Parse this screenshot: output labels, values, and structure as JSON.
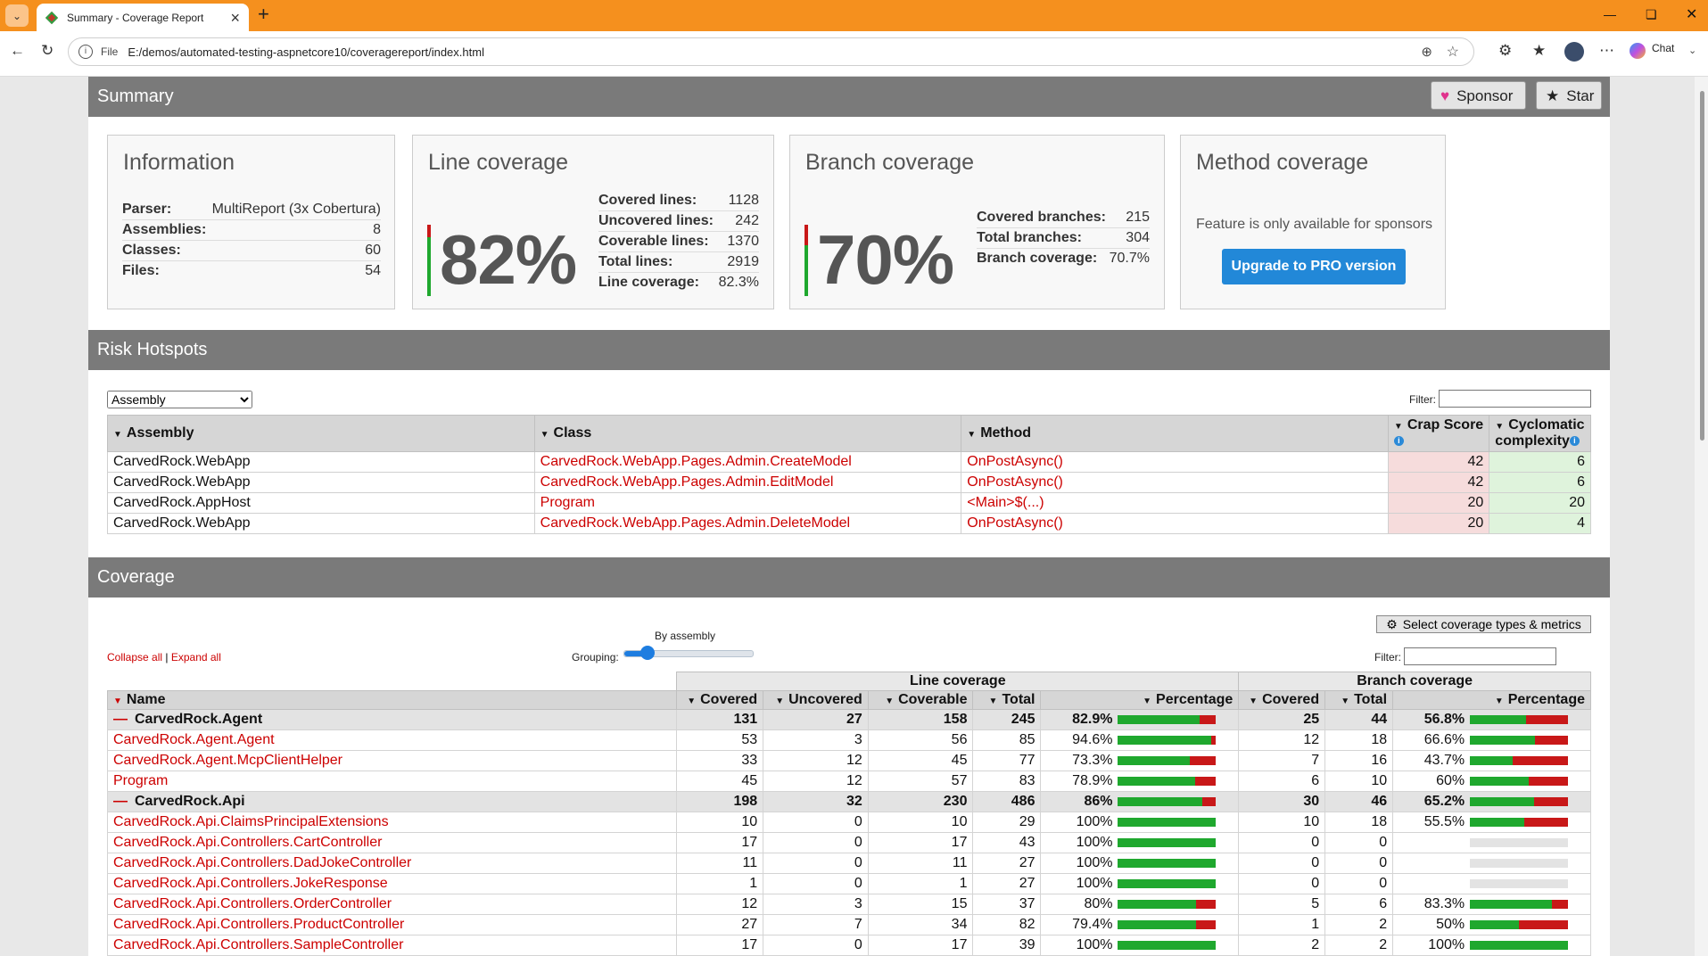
{
  "browser": {
    "tab_title": "Summary - Coverage Report",
    "url_scheme": "File",
    "url": "E:/demos/automated-testing-aspnetcore10/coveragereport/index.html",
    "chat_label": "Chat"
  },
  "summary": {
    "title": "Summary",
    "sponsor_label": "Sponsor",
    "star_label": "Star",
    "information": {
      "title": "Information",
      "rows": [
        {
          "k": "Parser:",
          "v": "MultiReport (3x Cobertura)"
        },
        {
          "k": "Assemblies:",
          "v": "8"
        },
        {
          "k": "Classes:",
          "v": "60"
        },
        {
          "k": "Files:",
          "v": "54"
        }
      ]
    },
    "line_coverage": {
      "title": "Line coverage",
      "percent": "82%",
      "rows": [
        {
          "k": "Covered lines:",
          "v": "1128"
        },
        {
          "k": "Uncovered lines:",
          "v": "242"
        },
        {
          "k": "Coverable lines:",
          "v": "1370"
        },
        {
          "k": "Total lines:",
          "v": "2919"
        },
        {
          "k": "Line coverage:",
          "v": "82.3%"
        }
      ],
      "fraction": 0.823
    },
    "branch_coverage": {
      "title": "Branch coverage",
      "percent": "70%",
      "rows": [
        {
          "k": "Covered branches:",
          "v": "215"
        },
        {
          "k": "Total branches:",
          "v": "304"
        },
        {
          "k": "Branch coverage:",
          "v": "70.7%"
        }
      ],
      "fraction": 0.707
    },
    "method_coverage": {
      "title": "Method coverage",
      "note": "Feature is only available for sponsors",
      "upgrade_label": "Upgrade to PRO version"
    }
  },
  "risk": {
    "title": "Risk Hotspots",
    "grouping_option": "Assembly",
    "filter_label": "Filter:",
    "headers": [
      "Assembly",
      "Class",
      "Method",
      "Crap Score",
      "Cyclomatic complexity"
    ],
    "rows": [
      {
        "assembly": "CarvedRock.WebApp",
        "class": "CarvedRock.WebApp.Pages.Admin.CreateModel",
        "method": "OnPostAsync()",
        "crap": "42",
        "cyc": "6"
      },
      {
        "assembly": "CarvedRock.WebApp",
        "class": "CarvedRock.WebApp.Pages.Admin.EditModel",
        "method": "OnPostAsync()",
        "crap": "42",
        "cyc": "6"
      },
      {
        "assembly": "CarvedRock.AppHost",
        "class": "Program",
        "method": "<Main>$(...)",
        "crap": "20",
        "cyc": "20"
      },
      {
        "assembly": "CarvedRock.WebApp",
        "class": "CarvedRock.WebApp.Pages.Admin.DeleteModel",
        "method": "OnPostAsync()",
        "crap": "20",
        "cyc": "4"
      }
    ]
  },
  "coverage": {
    "title": "Coverage",
    "collapse_label": "Collapse all",
    "expand_label": "Expand all",
    "grouping_label": "Grouping:",
    "grouping_value": "By assembly",
    "select_metrics_label": "Select coverage types & metrics",
    "filter_label": "Filter:",
    "group_line": "Line coverage",
    "group_branch": "Branch coverage",
    "headers": [
      "Name",
      "Covered",
      "Uncovered",
      "Coverable",
      "Total",
      "Percentage",
      "Covered",
      "Total",
      "Percentage"
    ],
    "rows": [
      {
        "type": "asm",
        "name": "CarvedRock.Agent",
        "covered": "131",
        "uncovered": "27",
        "coverable": "158",
        "total": "245",
        "pct": "82.9%",
        "lfrac": 0.829,
        "bcovered": "25",
        "btotal": "44",
        "bpct": "56.8%",
        "bfrac": 0.568
      },
      {
        "type": "cls",
        "name": "CarvedRock.Agent.Agent",
        "covered": "53",
        "uncovered": "3",
        "coverable": "56",
        "total": "85",
        "pct": "94.6%",
        "lfrac": 0.946,
        "bcovered": "12",
        "btotal": "18",
        "bpct": "66.6%",
        "bfrac": 0.666
      },
      {
        "type": "cls",
        "name": "CarvedRock.Agent.McpClientHelper",
        "covered": "33",
        "uncovered": "12",
        "coverable": "45",
        "total": "77",
        "pct": "73.3%",
        "lfrac": 0.733,
        "bcovered": "7",
        "btotal": "16",
        "bpct": "43.7%",
        "bfrac": 0.437
      },
      {
        "type": "cls",
        "name": "Program",
        "covered": "45",
        "uncovered": "12",
        "coverable": "57",
        "total": "83",
        "pct": "78.9%",
        "lfrac": 0.789,
        "bcovered": "6",
        "btotal": "10",
        "bpct": "60%",
        "bfrac": 0.6
      },
      {
        "type": "asm",
        "name": "CarvedRock.Api",
        "covered": "198",
        "uncovered": "32",
        "coverable": "230",
        "total": "486",
        "pct": "86%",
        "lfrac": 0.86,
        "bcovered": "30",
        "btotal": "46",
        "bpct": "65.2%",
        "bfrac": 0.652
      },
      {
        "type": "cls",
        "name": "CarvedRock.Api.ClaimsPrincipalExtensions",
        "covered": "10",
        "uncovered": "0",
        "coverable": "10",
        "total": "29",
        "pct": "100%",
        "lfrac": 1,
        "bcovered": "10",
        "btotal": "18",
        "bpct": "55.5%",
        "bfrac": 0.555
      },
      {
        "type": "cls",
        "name": "CarvedRock.Api.Controllers.CartController",
        "covered": "17",
        "uncovered": "0",
        "coverable": "17",
        "total": "43",
        "pct": "100%",
        "lfrac": 1,
        "bcovered": "0",
        "btotal": "0",
        "bpct": "",
        "bfrac": null
      },
      {
        "type": "cls",
        "name": "CarvedRock.Api.Controllers.DadJokeController",
        "covered": "11",
        "uncovered": "0",
        "coverable": "11",
        "total": "27",
        "pct": "100%",
        "lfrac": 1,
        "bcovered": "0",
        "btotal": "0",
        "bpct": "",
        "bfrac": null
      },
      {
        "type": "cls",
        "name": "CarvedRock.Api.Controllers.JokeResponse",
        "covered": "1",
        "uncovered": "0",
        "coverable": "1",
        "total": "27",
        "pct": "100%",
        "lfrac": 1,
        "bcovered": "0",
        "btotal": "0",
        "bpct": "",
        "bfrac": null
      },
      {
        "type": "cls",
        "name": "CarvedRock.Api.Controllers.OrderController",
        "covered": "12",
        "uncovered": "3",
        "coverable": "15",
        "total": "37",
        "pct": "80%",
        "lfrac": 0.8,
        "bcovered": "5",
        "btotal": "6",
        "bpct": "83.3%",
        "bfrac": 0.833
      },
      {
        "type": "cls",
        "name": "CarvedRock.Api.Controllers.ProductController",
        "covered": "27",
        "uncovered": "7",
        "coverable": "34",
        "total": "82",
        "pct": "79.4%",
        "lfrac": 0.794,
        "bcovered": "1",
        "btotal": "2",
        "bpct": "50%",
        "bfrac": 0.5
      },
      {
        "type": "cls",
        "name": "CarvedRock.Api.Controllers.SampleController",
        "covered": "17",
        "uncovered": "0",
        "coverable": "17",
        "total": "39",
        "pct": "100%",
        "lfrac": 1,
        "bcovered": "2",
        "btotal": "2",
        "bpct": "100%",
        "bfrac": 1
      }
    ]
  },
  "colors": {
    "chrome": "#f5901e",
    "covered": "#1fa82e",
    "uncovered": "#c81818",
    "link": "#cc0000",
    "header": "#7a7a7a"
  }
}
